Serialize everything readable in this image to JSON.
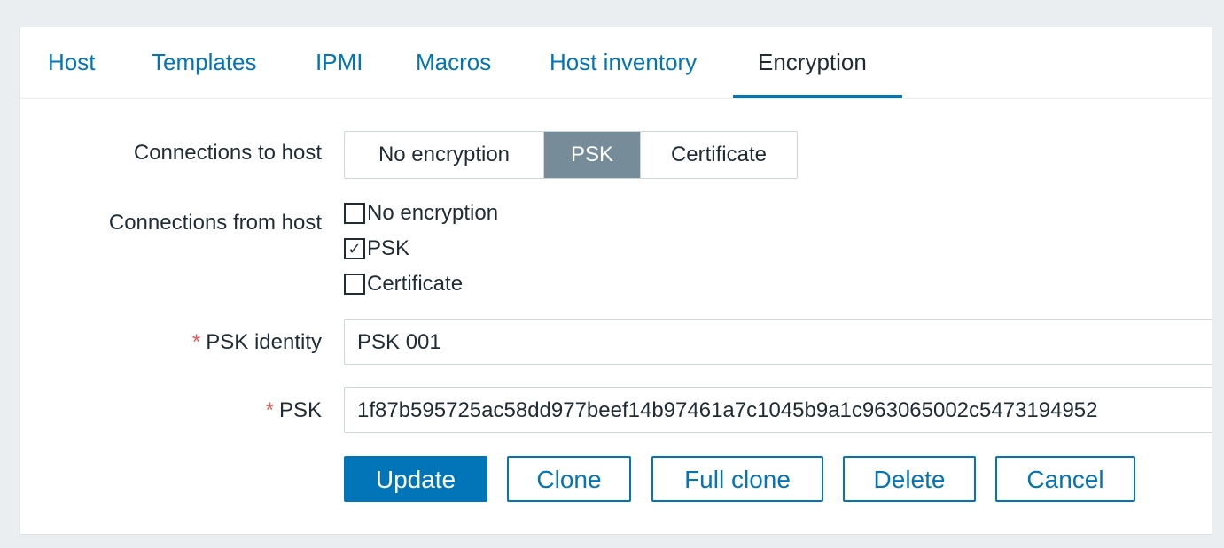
{
  "tabs": [
    {
      "label": "Host"
    },
    {
      "label": "Templates"
    },
    {
      "label": "IPMI"
    },
    {
      "label": "Macros"
    },
    {
      "label": "Host inventory"
    },
    {
      "label": "Encryption",
      "active": true
    }
  ],
  "connections_to_host": {
    "label": "Connections to host",
    "options": [
      "No encryption",
      "PSK",
      "Certificate"
    ],
    "selected": "PSK"
  },
  "connections_from_host": {
    "label": "Connections from host",
    "options": [
      {
        "label": "No encryption",
        "checked": false
      },
      {
        "label": "PSK",
        "checked": true
      },
      {
        "label": "Certificate",
        "checked": false
      }
    ],
    "check_glyph": "✓"
  },
  "psk_identity": {
    "required_mark": "*",
    "label": "PSK identity",
    "value": "PSK 001"
  },
  "psk": {
    "required_mark": "*",
    "label": "PSK",
    "value": "1f87b595725ac58dd977beef14b97461a7c1045b9a1c963065002c5473194952"
  },
  "buttons": {
    "update": "Update",
    "clone": "Clone",
    "full_clone": "Full clone",
    "delete": "Delete",
    "cancel": "Cancel"
  },
  "colors": {
    "link": "#0275b8",
    "selected_segment": "#768d99",
    "required": "#e45959",
    "background": "#ebeef0"
  }
}
